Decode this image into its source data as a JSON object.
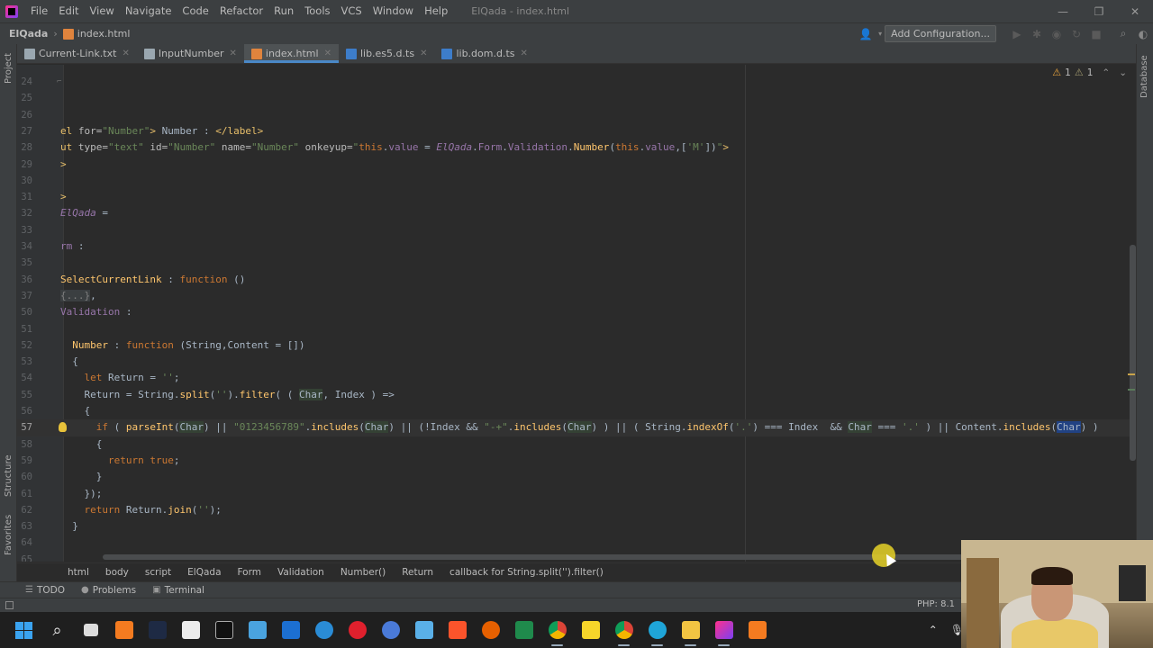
{
  "menubar": {
    "items": [
      "File",
      "Edit",
      "View",
      "Navigate",
      "Code",
      "Refactor",
      "Run",
      "Tools",
      "VCS",
      "Window",
      "Help"
    ],
    "title": "ElQada - index.html"
  },
  "navbar": {
    "project": "ElQada",
    "file": "index.html",
    "add_config": "Add Configuration..."
  },
  "stripes": {
    "left_top": "Project",
    "left_mid": "Structure",
    "left_bottom": "Favorites",
    "right_top": "Database"
  },
  "tabs": [
    {
      "label": "Current-Link.txt",
      "icon": "text-file-icon"
    },
    {
      "label": "InputNumber",
      "icon": "text-file-icon"
    },
    {
      "label": "index.html",
      "icon": "html-file-icon",
      "active": true
    },
    {
      "label": "lib.es5.d.ts",
      "icon": "typescript-file-icon"
    },
    {
      "label": "lib.dom.d.ts",
      "icon": "typescript-file-icon"
    }
  ],
  "inspections": {
    "warnings": "1",
    "weak_warnings": "1"
  },
  "line_numbers": [
    "24",
    "25",
    "26",
    "27",
    "28",
    "29",
    "30",
    "31",
    "32",
    "33",
    "34",
    "35",
    "36",
    "37",
    "50",
    "51",
    "52",
    "53",
    "54",
    "55",
    "56",
    "57",
    "58",
    "59",
    "60",
    "61",
    "62",
    "63",
    "64",
    "65"
  ],
  "breadcrumbs": [
    "html",
    "body",
    "script",
    "ElQada",
    "Form",
    "Validation",
    "Number()",
    "Return",
    "callback for String.split('').filter()"
  ],
  "tool_windows": [
    {
      "label": "TODO",
      "icon": "list-icon"
    },
    {
      "label": "Problems",
      "icon": "info-icon"
    },
    {
      "label": "Terminal",
      "icon": "terminal-icon"
    }
  ],
  "status": {
    "php_level": "PHP: 8.1"
  },
  "colors": {
    "editor_bg": "#2b2b2b",
    "panel_bg": "#3c3f41",
    "keyword": "#cc7832",
    "string": "#6a8759",
    "function": "#ffc66d",
    "field": "#9876aa",
    "tab_underline": "#4a88c7"
  }
}
